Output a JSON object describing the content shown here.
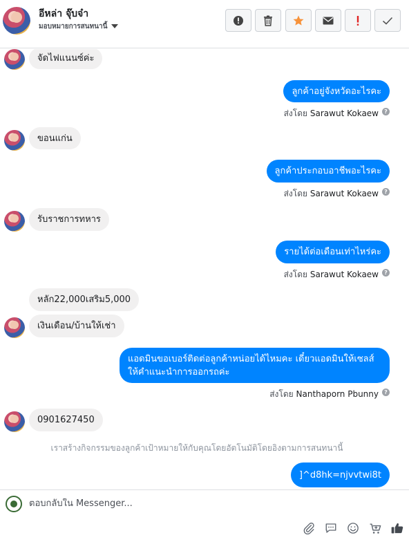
{
  "header": {
    "contact_name": "อีหล่า จุ๊บจ๋า",
    "assign_label": "มอบหมายการสนทนานี้"
  },
  "toolbar": {
    "buttons": [
      "spam",
      "delete",
      "star",
      "mark-unread",
      "follow-up",
      "done"
    ]
  },
  "messages": {
    "m1": "จัดไฟแนนซ์ค่ะ",
    "m2": "ลูกค้าอยู่จังหวัดอะไรคะ",
    "m3": "ขอนแก่น",
    "m4": "ลูกค้าประกอบอาชีพอะไรคะ",
    "m5": "รับราชการทหาร",
    "m6": "รายได้ต่อเดือนเท่าไหร่คะ",
    "m7": "หลัก22,000เสริม5,000",
    "m8": "เงินเดือน/บ้านให้เช่า",
    "m9_line1": "แอดมินขอเบอร์ติดต่อลูกค้าหน่อยได้ไหมคะ เดี๋ยวแอดมินให้เซลส์",
    "m9_line2": "ให้คำแนะนำการออกรถค่ะ",
    "m10": "0901627450",
    "m11": "]^d8hk=njvvtwi8t"
  },
  "sent_by": {
    "prefix": "ส่งโดย",
    "agent1": "Sarawut Kokaew",
    "agent2": "Nanthaporn Pbunny"
  },
  "system_note": "เราสร้างกิจกรรมของลูกค้าเป้าหมายให้กับคุณโดยอัตโนมัติโดยอิงตามการสนทนานี้",
  "composer": {
    "placeholder": "ตอบกลับใน Messenger..."
  },
  "colors": {
    "outgoing_bubble": "#0084ff",
    "incoming_bubble": "#f1f0f0",
    "star": "#f7923a",
    "follow_up": "#e02424"
  }
}
